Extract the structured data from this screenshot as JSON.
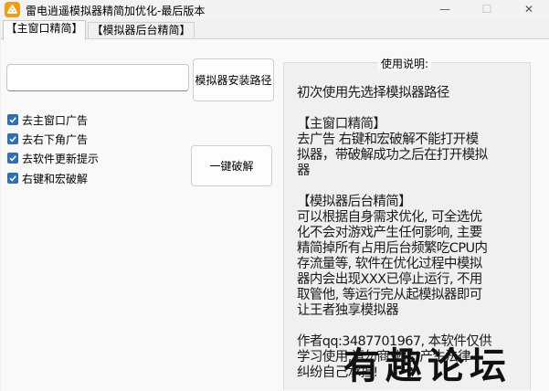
{
  "window": {
    "title": "雷电逍遥模拟器精简加优化-最后版本",
    "app_icon": "app-logo-icon",
    "controls": {
      "minimize": "—",
      "maximize": "☐",
      "close": "✕"
    },
    "accent": "#f39c12"
  },
  "tabs": [
    {
      "label": "【主窗口精简】",
      "selected": true
    },
    {
      "label": "【模拟器后台精简】",
      "selected": false
    }
  ],
  "main": {
    "path_input": {
      "value": "",
      "placeholder": ""
    },
    "path_button_label": "模拟器安装路径",
    "crack_button_label": "一键破解",
    "checkboxes": [
      {
        "label": "去主窗口广告",
        "checked": true
      },
      {
        "label": "去右下角广告",
        "checked": true
      },
      {
        "label": "去软件更新提示",
        "checked": true
      },
      {
        "label": "右键和宏破解",
        "checked": true
      }
    ],
    "checkbox_color": "#2f6fba"
  },
  "usage": {
    "title": "使用说明:",
    "lines": [
      "初次使用先选择模拟器路径",
      "",
      "【主窗口精简】",
      "去广告 右键和宏破解不能打开模",
      "拟器，带破解成功之后在打开模拟",
      "器",
      "",
      "【模拟器后台精简】",
      "可以根据自身需求优化, 可全选优",
      "化不会对游戏产生任何影响, 主要",
      "精简掉所有占用后台频繁吃CPU内",
      "存流量等, 软件在优化过程中模拟",
      "器内会出现XXX已停止运行, 不用",
      "取管他, 等运行完从起模拟器即可",
      "让王者独享模拟器",
      "",
      "作者qq:3487701967, 本软件仅供",
      "学习使用,请勿商业化!产生法律",
      "纠纷自己承担!"
    ]
  },
  "watermark": {
    "text": "有趣论坛"
  }
}
